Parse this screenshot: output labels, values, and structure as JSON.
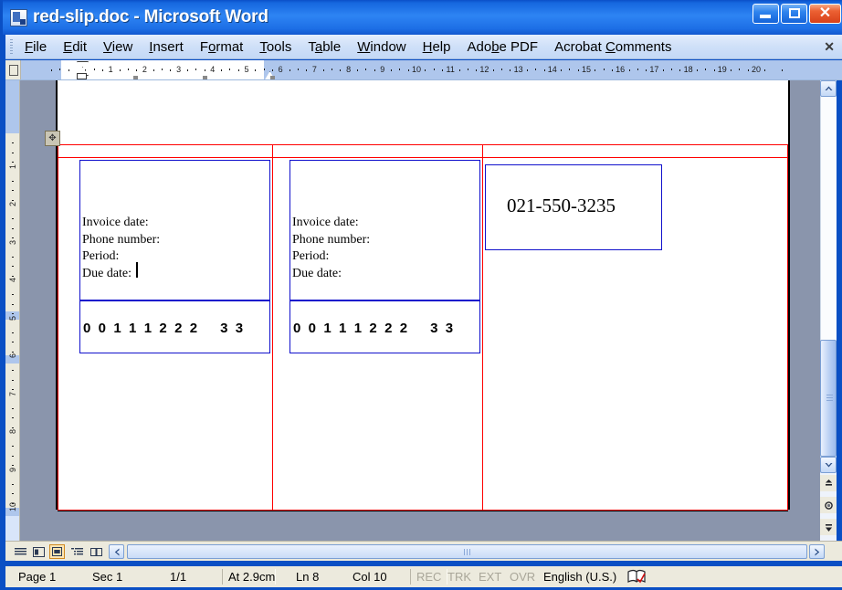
{
  "window": {
    "title": "red-slip.doc - Microsoft Word",
    "icon": "word-document-icon",
    "minimize_label": "Minimize",
    "maximize_label": "Maximize",
    "close_label": "Close"
  },
  "menubar": {
    "items": [
      {
        "label": "File",
        "accel": "F"
      },
      {
        "label": "Edit",
        "accel": "E"
      },
      {
        "label": "View",
        "accel": "V"
      },
      {
        "label": "Insert",
        "accel": "I"
      },
      {
        "label": "Format",
        "accel": "o"
      },
      {
        "label": "Tools",
        "accel": "T"
      },
      {
        "label": "Table",
        "accel": "a"
      },
      {
        "label": "Window",
        "accel": "W"
      },
      {
        "label": "Help",
        "accel": "H"
      },
      {
        "label": "Adobe PDF",
        "accel": "b"
      },
      {
        "label": "Acrobat Comments",
        "accel": "C"
      }
    ],
    "close_document_label": "✕"
  },
  "ruler": {
    "horizontal_ticks": [
      1,
      2,
      3,
      4,
      5,
      6,
      7,
      8,
      9,
      10,
      11,
      12,
      13,
      14,
      15,
      16,
      17,
      18,
      19,
      20
    ],
    "vertical_ticks": [
      1,
      2,
      3,
      4,
      5,
      6,
      7,
      8,
      9,
      10
    ],
    "units": "cm"
  },
  "document": {
    "slips": [
      {
        "lines": [
          "Invoice date:",
          "Phone number:",
          "Period:",
          "Due date:"
        ],
        "digits": "0  0  1  1  1  2  2  2      3  3",
        "has_caret": true
      },
      {
        "lines": [
          "Invoice date:",
          "Phone number:",
          "Period:",
          "Due date:"
        ],
        "digits": "0  0  1  1  1  2  2  2      3  3",
        "has_caret": false
      }
    ],
    "phone_number": "021-550-3235"
  },
  "viewbuttons": [
    {
      "name": "normal-view",
      "glyph": "≡",
      "selected": false
    },
    {
      "name": "web-layout-view",
      "glyph": "▨",
      "selected": false
    },
    {
      "name": "print-layout-view",
      "glyph": "□",
      "selected": true
    },
    {
      "name": "outline-view",
      "glyph": "☷",
      "selected": false
    },
    {
      "name": "reading-layout-view",
      "glyph": "◫",
      "selected": false
    }
  ],
  "scrollbar": {
    "up_glyph": "▲",
    "down_glyph": "▼",
    "left_glyph": "◀",
    "right_glyph": "▶",
    "prev_page_glyph": "⬍",
    "select_object_glyph": "●",
    "next_page_glyph": "⬍"
  },
  "statusbar": {
    "page": "Page 1",
    "section": "Sec 1",
    "pages": "1/1",
    "at": "At 2.9cm",
    "line": "Ln 8",
    "column": "Col 10",
    "rec": "REC",
    "trk": "TRK",
    "ext": "EXT",
    "ovr": "OVR",
    "language": "English (U.S.)",
    "spellcheck_icon": "spelling-and-grammar-icon"
  },
  "colors": {
    "title_bar": "#1567DE",
    "menu_bar": "#CFE0F8",
    "table_border": "#FF0000",
    "box_border": "#1111CC",
    "selected_view_button": "#D08A20",
    "document_background": "#8A95AC"
  }
}
